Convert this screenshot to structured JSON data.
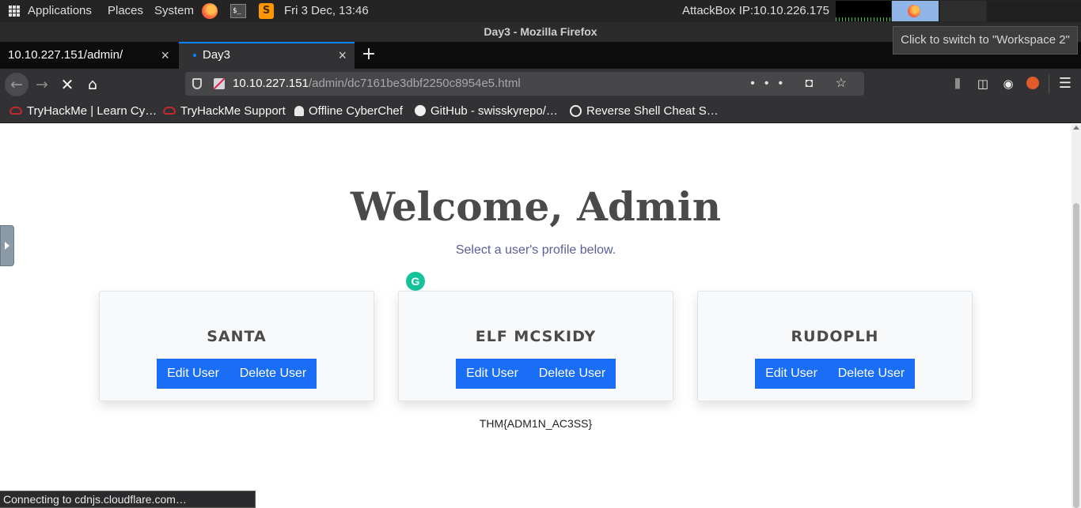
{
  "system_panel": {
    "applications": "Applications",
    "places": "Places",
    "system": "System",
    "clock": "Fri  3 Dec, 13:46",
    "attackbox": "AttackBox IP:10.10.226.175",
    "terminal_glyph": "$_",
    "sublime_glyph": "S"
  },
  "window": {
    "title": "Day3 - Mozilla Firefox",
    "workspace_tooltip": "Click to switch to \"Workspace 2\""
  },
  "tabs": [
    {
      "label": "10.10.227.151/admin/"
    },
    {
      "label": "Day3"
    }
  ],
  "tab_close": "×",
  "new_tab": "+",
  "nav": {
    "back": "←",
    "forward": "→",
    "stop": "✕",
    "home": "⌂",
    "url_host": "10.10.227.151",
    "url_path": "/admin/dc7161be3dbf2250c8954e5.html",
    "url_actions": "••• ◘ ☆",
    "library": "⫼",
    "sidebar": "◫",
    "account": "◉",
    "menu": "☰"
  },
  "bookmarks": [
    {
      "label": "TryHackMe | Learn Cy…",
      "icon": "tryhackme-icon"
    },
    {
      "label": "TryHackMe Support",
      "icon": "tryhackme-icon"
    },
    {
      "label": "Offline CyberChef",
      "icon": "chef-hat-icon"
    },
    {
      "label": "GitHub - swisskyrepo/…",
      "icon": "github-icon"
    },
    {
      "label": "Reverse Shell Cheat S…",
      "icon": "globe-icon"
    }
  ],
  "page": {
    "heading": "Welcome, Admin",
    "subtitle": "Select a user's profile below.",
    "grammarly_glyph": "G",
    "users": [
      {
        "name": "SANTA",
        "edit": "Edit User",
        "delete": "Delete User"
      },
      {
        "name": "ELF MCSKIDY",
        "edit": "Edit User",
        "delete": "Delete User"
      },
      {
        "name": "RUDOPLH",
        "edit": "Edit User",
        "delete": "Delete User"
      }
    ],
    "flag": "THM{ADM1N_AC3SS}"
  },
  "status": "Connecting to cdnjs.cloudflare.com…",
  "colors": {
    "accent": "#0a84ff",
    "button": "#1a6ef5",
    "heading": "#4a4a4a",
    "subtitle": "#5a5f99"
  }
}
